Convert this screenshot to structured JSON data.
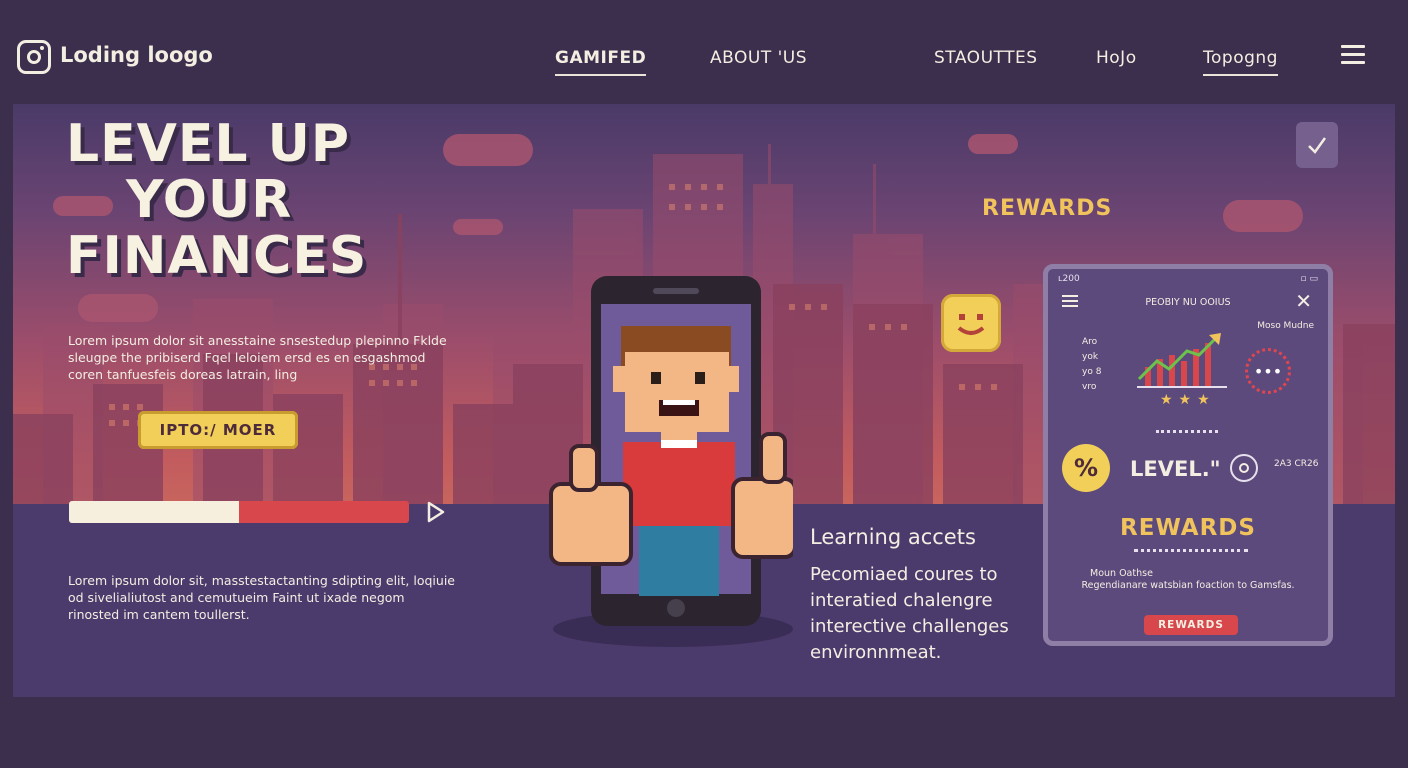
{
  "nav": {
    "logo_text": "Loding loogo",
    "links": [
      "GAMIFED",
      "ABOUT 'US",
      "STAOUTTES",
      "HoJo",
      "Topogng"
    ]
  },
  "hero": {
    "title_lines": [
      "LEVEL UP",
      "YOUR",
      "FINANCES"
    ],
    "intro_text": "Lorem ipsum dolor sit anesstaine snsestedup plepinno Fklde sleugpe the pribiserd Fqel leloiem ersd es en esgashmod coren tanfuesfeis doreas latrain, ling",
    "cta_label": "IPTO:/ MOER",
    "progress_fraction": 0.5,
    "body_text": "Lorem ipsum dolor sit, masstestactanting sdipting elit, loqiuie od sivelialiutost and cemutueim Faint ut ixade negom rinosted im cantem toullerst.",
    "rewards_label": "REWARDS",
    "learning_title": "Learning accets",
    "learning_body": "Pecomiaed coures to interatied chalengre interective challenges environnmeat."
  },
  "phone": {
    "status_left": "ʟ200",
    "status_right": "▫ ▭",
    "title": "PEOBIY NU OOIUS",
    "label_right": "Moso Mudne",
    "labels_left": [
      "Aro",
      "yok",
      "yo 8",
      "vro"
    ],
    "more_label": "•••",
    "percent_label": "%",
    "level_label": "LEVEL.\"",
    "level_info": "2A3 CR26",
    "rewards_label": "REWARDS",
    "small_title": "Moun Oathse",
    "small_body": "Regendianare watsbian foaction to Gamsfas.",
    "button_label": "REWARDS",
    "stars": "★★★"
  },
  "colors": {
    "accent_yellow": "#f1cf58",
    "accent_red": "#d8474c",
    "bg": "#3b2f4d",
    "ground": "#4b3b6d"
  }
}
